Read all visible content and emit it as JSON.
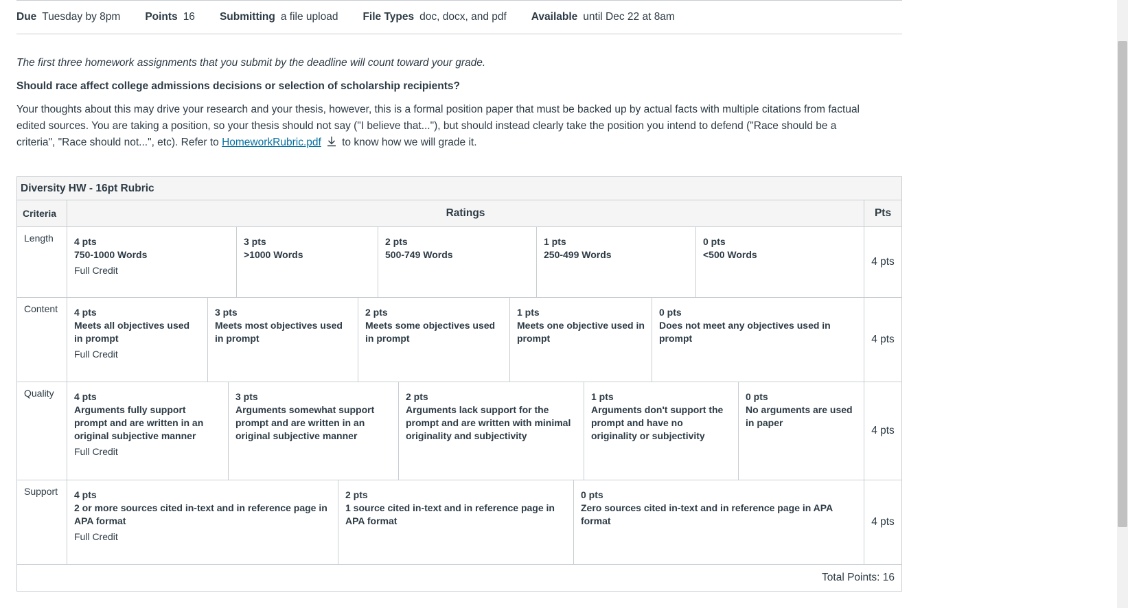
{
  "details": [
    {
      "label": "Due",
      "value": "Tuesday by 8pm"
    },
    {
      "label": "Points",
      "value": "16"
    },
    {
      "label": "Submitting",
      "value": "a file upload"
    },
    {
      "label": "File Types",
      "value": "doc, docx, and pdf"
    },
    {
      "label": "Available",
      "value": "until Dec 22 at 8am"
    }
  ],
  "description": {
    "intro": "The first three homework assignments that you submit by the deadline will count toward your grade.",
    "question": "Should race affect college admissions decisions or selection of scholarship recipients?",
    "paragraph": "Your thoughts about this may drive your research and your thesis, however, this is a formal position paper that must be backed up by actual facts with multiple citations from factual edited sources. You are taking a position, so your thesis should not say (\"I believe that...\"), but should instead clearly take the position you intend to defend (\"Race should be a criteria\", \"Race should not...\", etc). Refer to ",
    "link_text": "HomeworkRubric.pdf",
    "after_link": " to know how we will grade it."
  },
  "rubric": {
    "title": "Diversity HW - 16pt Rubric",
    "headers": {
      "criteria": "Criteria",
      "ratings": "Ratings",
      "pts": "Pts"
    },
    "rows": [
      {
        "criteria": "Length",
        "points": "4 pts",
        "ratings": [
          {
            "pts": "4 pts",
            "desc": "750-1000 Words",
            "extra": "Full Credit"
          },
          {
            "pts": "3 pts",
            "desc": ">1000 Words",
            "extra": ""
          },
          {
            "pts": "2 pts",
            "desc": "500-749 Words",
            "extra": ""
          },
          {
            "pts": "1 pts",
            "desc": "250-499 Words",
            "extra": ""
          },
          {
            "pts": "0 pts",
            "desc": "<500 Words",
            "extra": ""
          }
        ]
      },
      {
        "criteria": "Content",
        "points": "4 pts",
        "ratings": [
          {
            "pts": "4 pts",
            "desc": "Meets all objectives used in prompt",
            "extra": "Full Credit"
          },
          {
            "pts": "3 pts",
            "desc": "Meets most objectives used in prompt",
            "extra": ""
          },
          {
            "pts": "2 pts",
            "desc": "Meets some objectives used in prompt",
            "extra": ""
          },
          {
            "pts": "1 pts",
            "desc": "Meets one objective used in prompt",
            "extra": ""
          },
          {
            "pts": "0 pts",
            "desc": "Does not meet any objectives used in prompt",
            "extra": ""
          }
        ]
      },
      {
        "criteria": "Quality",
        "points": "4 pts",
        "ratings": [
          {
            "pts": "4 pts",
            "desc": "Arguments fully support prompt and are written in an original subjective manner",
            "extra": "Full Credit"
          },
          {
            "pts": "3 pts",
            "desc": "Arguments somewhat support prompt and are written in an original subjective manner",
            "extra": ""
          },
          {
            "pts": "2 pts",
            "desc": "Arguments lack support for the prompt and are written with minimal originality and subjectivity",
            "extra": ""
          },
          {
            "pts": "1 pts",
            "desc": "Arguments don't support the prompt and have no originality or subjectivity",
            "extra": ""
          },
          {
            "pts": "0 pts",
            "desc": "No arguments are used in paper",
            "extra": ""
          }
        ]
      },
      {
        "criteria": "Support",
        "points": "4 pts",
        "ratings": [
          {
            "pts": "4 pts",
            "desc": "2 or more sources cited in-text and in reference page in APA format",
            "extra": "Full Credit"
          },
          {
            "pts": "2 pts",
            "desc": "1 source cited in-text and in reference page in APA format",
            "extra": ""
          },
          {
            "pts": "0 pts",
            "desc": "Zero sources cited in-text and in reference page in APA format",
            "extra": ""
          }
        ]
      }
    ],
    "total": "Total Points: 16"
  },
  "icons": {
    "download": "download-icon"
  },
  "colors": {
    "link": "#0770a3",
    "border": "#c7cdd1",
    "header_bg": "#f5f5f5",
    "text": "#2d3b45"
  }
}
